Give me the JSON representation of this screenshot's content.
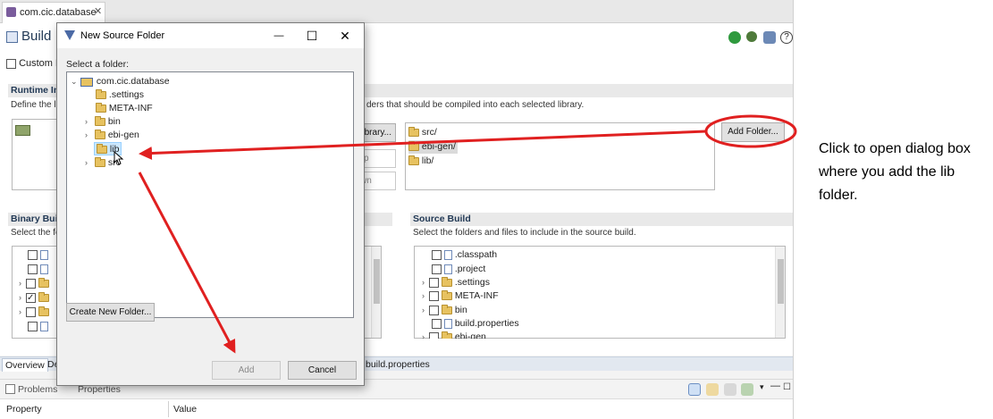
{
  "editor": {
    "tab_label": "com.cic.database",
    "page_title": "Build",
    "custom_checkbox_label": "Custom B",
    "runtime_header": "Runtime In",
    "runtime_desc_left": "Define the li",
    "runtime_desc_right": "ders that should be compiled into each selected library.",
    "library_button": "brary...",
    "up_button": "p",
    "down_button": "wn",
    "add_folder_button": "Add Folder...",
    "library_folders": [
      "src/",
      "ebi-gen/",
      "lib/"
    ],
    "binary_header": "Binary Buil",
    "binary_desc": "Select the fo",
    "source_header": "Source Build",
    "source_desc": "Select the folders and files to include in the source build.",
    "source_items": [
      {
        "label": ".classpath",
        "type": "file",
        "chevron": false
      },
      {
        "label": ".project",
        "type": "file",
        "chevron": false
      },
      {
        "label": ".settings",
        "type": "folder",
        "chevron": true
      },
      {
        "label": "META-INF",
        "type": "folder",
        "chevron": true
      },
      {
        "label": "bin",
        "type": "folder",
        "chevron": true
      },
      {
        "label": "build.properties",
        "type": "file",
        "chevron": false
      },
      {
        "label": "ebi-gen",
        "type": "folder",
        "chevron": true
      }
    ]
  },
  "bottom_tabs": {
    "overview": "Overview",
    "dependencies": "De",
    "build_properties": "build.properties"
  },
  "views": {
    "problems": "Problems",
    "properties": "Properties",
    "col_property": "Property",
    "col_value": "Value"
  },
  "dialog": {
    "title": "New Source Folder",
    "minimize": "—",
    "maximize": "☐",
    "close": "✕",
    "prompt": "Select a folder:",
    "tree_root": "com.cic.database",
    "tree_items": [
      ".settings",
      "META-INF",
      "bin",
      "ebi-gen",
      "lib",
      "src"
    ],
    "create_folder_button": "Create New Folder...",
    "add_button": "Add",
    "cancel_button": "Cancel"
  },
  "annotation": {
    "text": "Click to open dialog box where you add the lib folder.",
    "color": "#e02020"
  }
}
